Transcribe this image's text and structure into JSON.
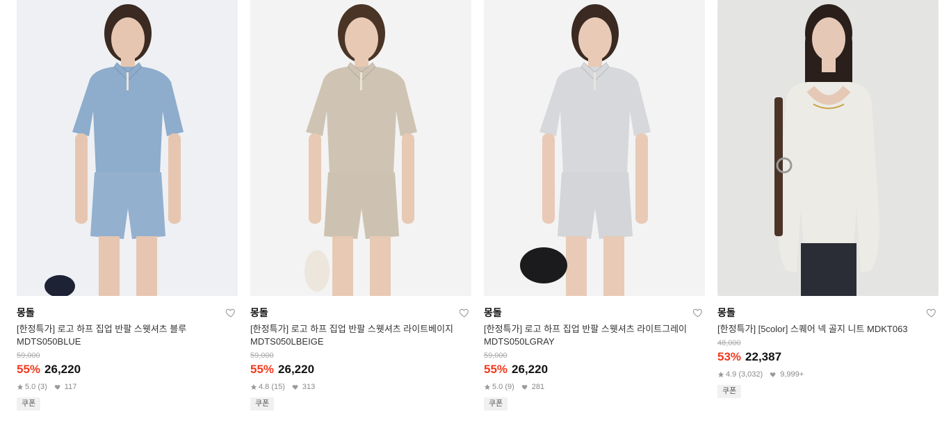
{
  "products": [
    {
      "brand": "몽돌",
      "title": "[한정특가] 로고 하프 집업 반팔 스웻셔츠 블루 MDTS050BLUE",
      "original_price": "59,000",
      "discount": "55%",
      "price": "26,220",
      "rating": "5.0 (3)",
      "likes": "117",
      "badge": "쿠폰",
      "colors": {
        "bg": "#eef0f3",
        "top": "#8eaccc",
        "bottom": "#93b0cf",
        "skin": "#e6c6b0",
        "hair": "#3a2a22"
      }
    },
    {
      "brand": "몽돌",
      "title": "[한정특가] 로고 하프 집업 반팔 스웻셔츠 라이트베이지 MDTS050LBEIGE",
      "original_price": "59,000",
      "discount": "55%",
      "price": "26,220",
      "rating": "4.8 (15)",
      "likes": "313",
      "badge": "쿠폰",
      "colors": {
        "bg": "#f3f3f3",
        "top": "#cfc4b4",
        "bottom": "#cdc2b1",
        "skin": "#e7c9b4",
        "hair": "#4a3426"
      }
    },
    {
      "brand": "몽돌",
      "title": "[한정특가] 로고 하프 집업 반팔 스웻셔츠 라이트그레이 MDTS050LGRAY",
      "original_price": "59,000",
      "discount": "55%",
      "price": "26,220",
      "rating": "5.0 (9)",
      "likes": "281",
      "badge": "쿠폰",
      "colors": {
        "bg": "#f3f3f3",
        "top": "#d6d8dc",
        "bottom": "#d3d5d9",
        "skin": "#e8cab6",
        "hair": "#3b2a21"
      }
    },
    {
      "brand": "몽돌",
      "title": "[한정특가] [5color] 스퀘어 넥 골지 니트 MDKT063",
      "original_price": "48,000",
      "discount": "53%",
      "price": "22,387",
      "rating": "4.9 (3,032)",
      "likes": "9,999+",
      "badge": "쿠폰",
      "colors": {
        "bg": "#e4e4e2",
        "top": "#ecebe5",
        "bottom": "#2a2d36",
        "skin": "#e5c8b6",
        "hair": "#2a1f1a"
      }
    }
  ]
}
